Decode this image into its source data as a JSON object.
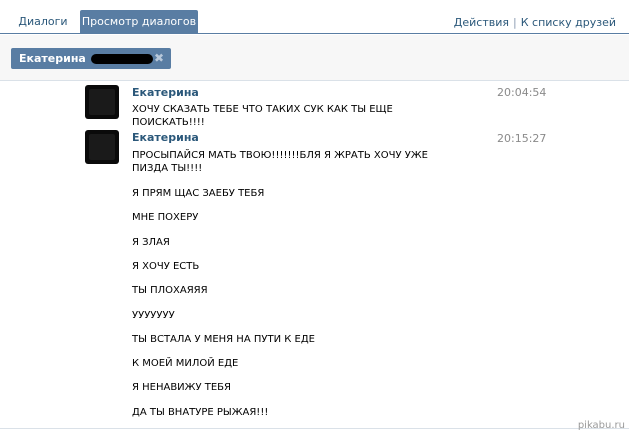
{
  "tabs": [
    {
      "label": "Диалоги"
    },
    {
      "label": "Просмотр диалогов"
    }
  ],
  "header_links": {
    "actions": "Действия",
    "separator": "|",
    "friends": "К списку друзей"
  },
  "filter_chip": {
    "name": "Екатерина",
    "close": "✖"
  },
  "messages": [
    {
      "author": "Екатерина",
      "time": "20:04:54",
      "lines": [
        "ХОЧУ СКАЗАТЬ ТЕБЕ ЧТО ТАКИХ СУК КАК ТЫ ЕЩЕ ПОИСКАТЬ!!!!"
      ]
    },
    {
      "author": "Екатерина",
      "time": "20:15:27",
      "lines": [
        "ПРОСЫПАЙСЯ МАТЬ ТВОЮ!!!!!!!БЛЯ Я ЖРАТЬ ХОЧУ УЖЕ ПИЗДА ТЫ!!!!",
        "Я ПРЯМ ЩАС ЗАЕБУ ТЕБЯ",
        "МНЕ ПОХЕРУ",
        "Я ЗЛАЯ",
        "Я ХОЧУ ЕСТЬ",
        "ТЫ ПЛОХАЯЯЯ",
        "УУУУУУУ",
        "ТЫ ВСТАЛА У МЕНЯ НА ПУТИ К ЕДЕ",
        "К МОЕЙ МИЛОЙ ЕДЕ",
        "Я НЕНАВИЖУ ТЕБЯ",
        "ДА ТЫ ВНАТУРЕ РЫЖАЯ!!!"
      ]
    }
  ],
  "watermark": "pikabu.ru",
  "colors": {
    "accent": "#597da3",
    "link": "#2b587a",
    "time": "#8a8a8a"
  }
}
